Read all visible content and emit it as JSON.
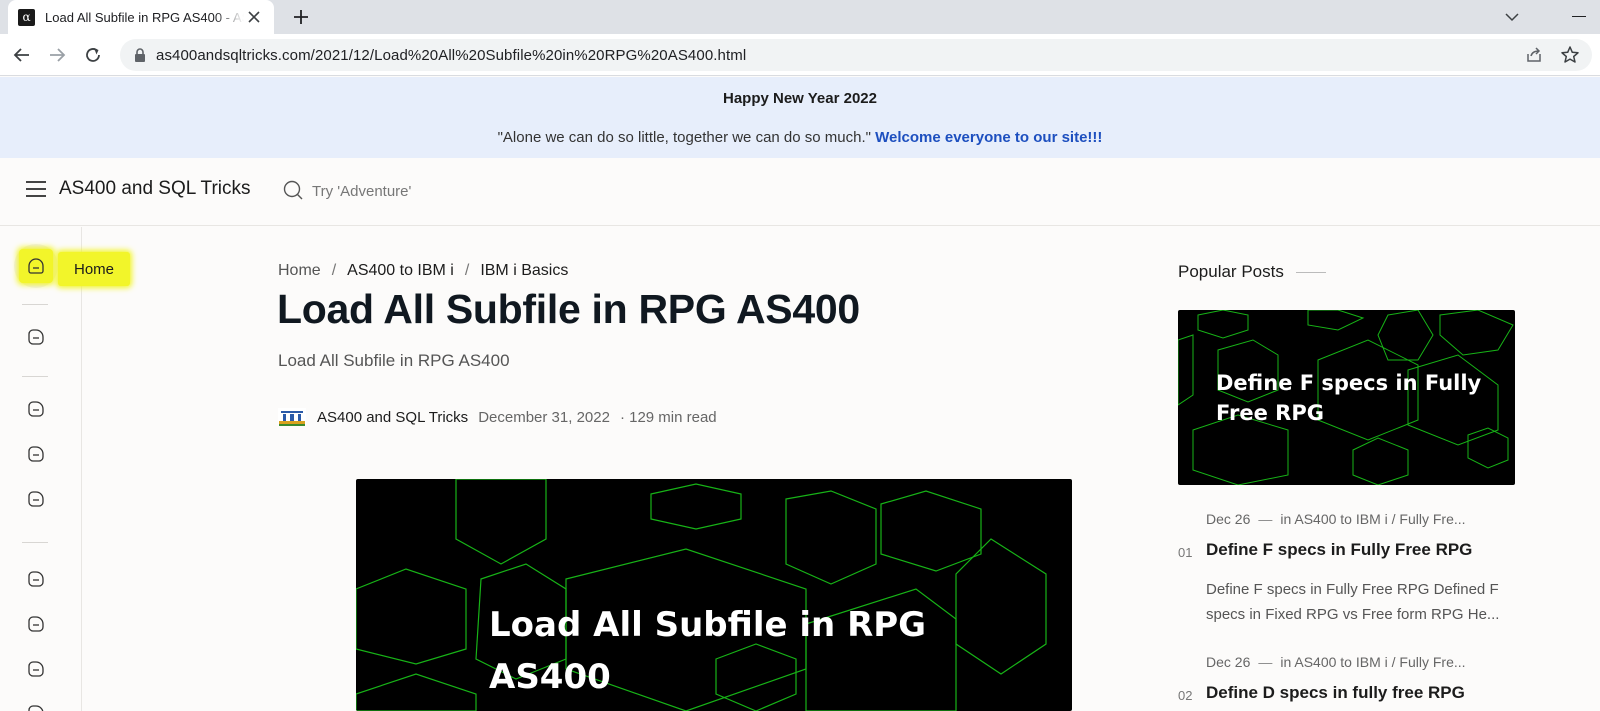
{
  "browser": {
    "tab_title": "Load All Subfile in RPG AS400 - AS400 and SQL Tricks",
    "favicon_glyph": "α",
    "url": "as400andsqltricks.com/2021/12/Load%20All%20Subfile%20in%20RPG%20AS400.html"
  },
  "announcement": {
    "title": "Happy New Year 2022",
    "quote": "\"Alone we can do so little, together we can do so much.\"",
    "link_text": "Welcome everyone to our site!!!"
  },
  "header": {
    "site_title": "AS400 and SQL Tricks",
    "search_placeholder": "Try 'Adventure'"
  },
  "nav": {
    "home_label": "Home",
    "highlight_color": "#f2f52a"
  },
  "breadcrumb": {
    "items": [
      "Home",
      "AS400 to IBM i",
      "IBM i Basics"
    ],
    "separator": "/"
  },
  "post": {
    "title": "Load All Subfile in RPG AS400",
    "subtitle": "Load All Subfile in RPG AS400",
    "author": "AS400 and SQL Tricks",
    "date": "December 31, 2022",
    "read_time": "· 129 min read",
    "hero_text": "Load All Subfile in RPG AS400"
  },
  "sidebar": {
    "title": "Popular Posts",
    "featured_image_text": "Define F specs in Fully Free RPG",
    "posts": [
      {
        "number": "01",
        "date": "Dec 26",
        "category": "in AS400 to IBM i / Fully Fre...",
        "title": "Define F specs in Fully Free RPG",
        "snippet": "Define F specs in Fully Free RPG Defined F specs in Fixed RPG vs Free form RPG He..."
      },
      {
        "number": "02",
        "date": "Dec 26",
        "category": "in AS400 to IBM i / Fully Fre...",
        "title": "Define D specs in fully free RPG"
      }
    ]
  },
  "colors": {
    "accent_link": "#1d4fbf",
    "announcement_bg": "#e7eefb",
    "hexagon_stroke": "#17b317"
  }
}
